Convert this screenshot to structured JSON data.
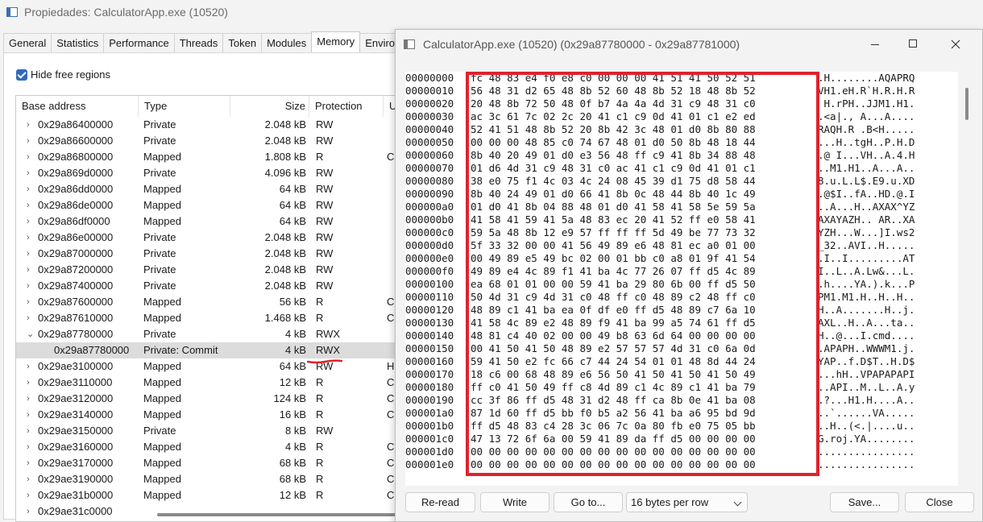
{
  "props_window": {
    "title": "Propiedades: CalculatorApp.exe (10520)",
    "tabs": [
      "General",
      "Statistics",
      "Performance",
      "Threads",
      "Token",
      "Modules",
      "Memory",
      "Environm"
    ],
    "active_tab": "Memory",
    "hide_free_label": "Hide free regions",
    "hide_free_checked": true,
    "columns": [
      "Base address",
      "Type",
      "Size",
      "Protection",
      "Us"
    ],
    "regions": [
      {
        "chevron": "›",
        "address": "0x29a86400000",
        "type": "Private",
        "size": "2.048 kB",
        "protection": "RW",
        "use": ""
      },
      {
        "chevron": "›",
        "address": "0x29a86600000",
        "type": "Private",
        "size": "2.048 kB",
        "protection": "RW",
        "use": ""
      },
      {
        "chevron": "›",
        "address": "0x29a86800000",
        "type": "Mapped",
        "size": "1.808 kB",
        "protection": "R",
        "use": "C"
      },
      {
        "chevron": "›",
        "address": "0x29a869d0000",
        "type": "Private",
        "size": "4.096 kB",
        "protection": "RW",
        "use": ""
      },
      {
        "chevron": "›",
        "address": "0x29a86dd0000",
        "type": "Mapped",
        "size": "64 kB",
        "protection": "RW",
        "use": ""
      },
      {
        "chevron": "›",
        "address": "0x29a86de0000",
        "type": "Mapped",
        "size": "64 kB",
        "protection": "RW",
        "use": ""
      },
      {
        "chevron": "›",
        "address": "0x29a86df0000",
        "type": "Mapped",
        "size": "64 kB",
        "protection": "RW",
        "use": ""
      },
      {
        "chevron": "›",
        "address": "0x29a86e00000",
        "type": "Private",
        "size": "2.048 kB",
        "protection": "RW",
        "use": ""
      },
      {
        "chevron": "›",
        "address": "0x29a87000000",
        "type": "Private",
        "size": "2.048 kB",
        "protection": "RW",
        "use": ""
      },
      {
        "chevron": "›",
        "address": "0x29a87200000",
        "type": "Private",
        "size": "2.048 kB",
        "protection": "RW",
        "use": ""
      },
      {
        "chevron": "›",
        "address": "0x29a87400000",
        "type": "Private",
        "size": "2.048 kB",
        "protection": "RW",
        "use": ""
      },
      {
        "chevron": "›",
        "address": "0x29a87600000",
        "type": "Mapped",
        "size": "56 kB",
        "protection": "R",
        "use": "C"
      },
      {
        "chevron": "›",
        "address": "0x29a87610000",
        "type": "Mapped",
        "size": "1.468 kB",
        "protection": "R",
        "use": "C"
      },
      {
        "chevron": "⌄",
        "address": "0x29a87780000",
        "type": "Private",
        "size": "4 kB",
        "protection": "RWX",
        "use": ""
      },
      {
        "chevron": "",
        "address": "0x29a87780000",
        "type": "Private: Commit",
        "size": "4 kB",
        "protection": "RWX",
        "use": "",
        "child": true,
        "selected": true
      },
      {
        "chevron": "›",
        "address": "0x29ae3100000",
        "type": "Mapped",
        "size": "64 kB",
        "protection": "RW",
        "use": "H"
      },
      {
        "chevron": "›",
        "address": "0x29ae3110000",
        "type": "Mapped",
        "size": "12 kB",
        "protection": "R",
        "use": "C"
      },
      {
        "chevron": "›",
        "address": "0x29ae3120000",
        "type": "Mapped",
        "size": "124 kB",
        "protection": "R",
        "use": "C"
      },
      {
        "chevron": "›",
        "address": "0x29ae3140000",
        "type": "Mapped",
        "size": "16 kB",
        "protection": "R",
        "use": "C"
      },
      {
        "chevron": "›",
        "address": "0x29ae3150000",
        "type": "Private",
        "size": "8 kB",
        "protection": "RW",
        "use": ""
      },
      {
        "chevron": "›",
        "address": "0x29ae3160000",
        "type": "Mapped",
        "size": "4 kB",
        "protection": "R",
        "use": "C"
      },
      {
        "chevron": "›",
        "address": "0x29ae3170000",
        "type": "Mapped",
        "size": "68 kB",
        "protection": "R",
        "use": "C"
      },
      {
        "chevron": "›",
        "address": "0x29ae3190000",
        "type": "Mapped",
        "size": "68 kB",
        "protection": "R",
        "use": "C"
      },
      {
        "chevron": "›",
        "address": "0x29ae31b0000",
        "type": "Mapped",
        "size": "12 kB",
        "protection": "R",
        "use": "C"
      },
      {
        "chevron": "›",
        "address": "0x29ae31c0000",
        "type": "",
        "size": "",
        "protection": "",
        "use": ""
      }
    ]
  },
  "mem_window": {
    "title": "CalculatorApp.exe (10520) (0x29a87780000 - 0x29a87781000)",
    "hex": [
      {
        "offset": "00000000",
        "bytes": "fc 48 83 e4 f0 e8 c0 00 00 00 41 51 41 50 52 51",
        "ascii": ".H........AQAPRQ"
      },
      {
        "offset": "00000010",
        "bytes": "56 48 31 d2 65 48 8b 52 60 48 8b 52 18 48 8b 52",
        "ascii": "VH1.eH.R`H.R.H.R"
      },
      {
        "offset": "00000020",
        "bytes": "20 48 8b 72 50 48 0f b7 4a 4a 4d 31 c9 48 31 c0",
        "ascii": " H.rPH..JJM1.H1."
      },
      {
        "offset": "00000030",
        "bytes": "ac 3c 61 7c 02 2c 20 41 c1 c9 0d 41 01 c1 e2 ed",
        "ascii": ".<a|., A...A...."
      },
      {
        "offset": "00000040",
        "bytes": "52 41 51 48 8b 52 20 8b 42 3c 48 01 d0 8b 80 88",
        "ascii": "RAQH.R .B<H....."
      },
      {
        "offset": "00000050",
        "bytes": "00 00 00 48 85 c0 74 67 48 01 d0 50 8b 48 18 44",
        "ascii": "...H..tgH..P.H.D"
      },
      {
        "offset": "00000060",
        "bytes": "8b 40 20 49 01 d0 e3 56 48 ff c9 41 8b 34 88 48",
        "ascii": ".@ I...VH..A.4.H"
      },
      {
        "offset": "00000070",
        "bytes": "01 d6 4d 31 c9 48 31 c0 ac 41 c1 c9 0d 41 01 c1",
        "ascii": "..M1.H1..A...A.."
      },
      {
        "offset": "00000080",
        "bytes": "38 e0 75 f1 4c 03 4c 24 08 45 39 d1 75 d8 58 44",
        "ascii": "8.u.L.L$.E9.u.XD"
      },
      {
        "offset": "00000090",
        "bytes": "8b 40 24 49 01 d0 66 41 8b 0c 48 44 8b 40 1c 49",
        "ascii": ".@$I..fA..HD.@.I"
      },
      {
        "offset": "000000a0",
        "bytes": "01 d0 41 8b 04 88 48 01 d0 41 58 41 58 5e 59 5a",
        "ascii": "..A...H..AXAX^YZ"
      },
      {
        "offset": "000000b0",
        "bytes": "41 58 41 59 41 5a 48 83 ec 20 41 52 ff e0 58 41",
        "ascii": "AXAYAZH.. AR..XA"
      },
      {
        "offset": "000000c0",
        "bytes": "59 5a 48 8b 12 e9 57 ff ff ff 5d 49 be 77 73 32",
        "ascii": "YZH...W...]I.ws2"
      },
      {
        "offset": "000000d0",
        "bytes": "5f 33 32 00 00 41 56 49 89 e6 48 81 ec a0 01 00",
        "ascii": "_32..AVI..H....."
      },
      {
        "offset": "000000e0",
        "bytes": "00 49 89 e5 49 bc 02 00 01 bb c0 a8 01 9f 41 54",
        "ascii": ".I..I.........AT"
      },
      {
        "offset": "000000f0",
        "bytes": "49 89 e4 4c 89 f1 41 ba 4c 77 26 07 ff d5 4c 89",
        "ascii": "I..L..A.Lw&...L."
      },
      {
        "offset": "00000100",
        "bytes": "ea 68 01 01 00 00 59 41 ba 29 80 6b 00 ff d5 50",
        "ascii": ".h....YA.).k...P"
      },
      {
        "offset": "00000110",
        "bytes": "50 4d 31 c9 4d 31 c0 48 ff c0 48 89 c2 48 ff c0",
        "ascii": "PM1.M1.H..H..H.."
      },
      {
        "offset": "00000120",
        "bytes": "48 89 c1 41 ba ea 0f df e0 ff d5 48 89 c7 6a 10",
        "ascii": "H..A.......H..j."
      },
      {
        "offset": "00000130",
        "bytes": "41 58 4c 89 e2 48 89 f9 41 ba 99 a5 74 61 ff d5",
        "ascii": "AXL..H..A...ta.."
      },
      {
        "offset": "00000140",
        "bytes": "48 81 c4 40 02 00 00 49 b8 63 6d 64 00 00 00 00",
        "ascii": "H..@...I.cmd...."
      },
      {
        "offset": "00000150",
        "bytes": "00 41 50 41 50 48 89 e2 57 57 57 4d 31 c0 6a 0d",
        "ascii": ".APAPH..WWWM1.j."
      },
      {
        "offset": "00000160",
        "bytes": "59 41 50 e2 fc 66 c7 44 24 54 01 01 48 8d 44 24",
        "ascii": "YAP..f.D$T..H.D$"
      },
      {
        "offset": "00000170",
        "bytes": "18 c6 00 68 48 89 e6 56 50 41 50 41 50 41 50 49",
        "ascii": "...hH..VPAPAPAPI"
      },
      {
        "offset": "00000180",
        "bytes": "ff c0 41 50 49 ff c8 4d 89 c1 4c 89 c1 41 ba 79",
        "ascii": "..API..M..L..A.y"
      },
      {
        "offset": "00000190",
        "bytes": "cc 3f 86 ff d5 48 31 d2 48 ff ca 8b 0e 41 ba 08",
        "ascii": ".?...H1.H....A.."
      },
      {
        "offset": "000001a0",
        "bytes": "87 1d 60 ff d5 bb f0 b5 a2 56 41 ba a6 95 bd 9d",
        "ascii": "..`......VA....."
      },
      {
        "offset": "000001b0",
        "bytes": "ff d5 48 83 c4 28 3c 06 7c 0a 80 fb e0 75 05 bb",
        "ascii": "..H..(<.|....u.."
      },
      {
        "offset": "000001c0",
        "bytes": "47 13 72 6f 6a 00 59 41 89 da ff d5 00 00 00 00",
        "ascii": "G.roj.YA........"
      },
      {
        "offset": "000001d0",
        "bytes": "00 00 00 00 00 00 00 00 00 00 00 00 00 00 00 00",
        "ascii": "................"
      },
      {
        "offset": "000001e0",
        "bytes": "00 00 00 00 00 00 00 00 00 00 00 00 00 00 00 00",
        "ascii": "................"
      }
    ],
    "buttons": {
      "reread": "Re-read",
      "write": "Write",
      "goto": "Go to...",
      "bytes_per_row": "16 bytes per row",
      "save": "Save...",
      "close": "Close"
    }
  },
  "colors": {
    "highlight_box": "#e0222c",
    "selected_row": "#dcdcdc",
    "accent": "#2e6bbd"
  }
}
